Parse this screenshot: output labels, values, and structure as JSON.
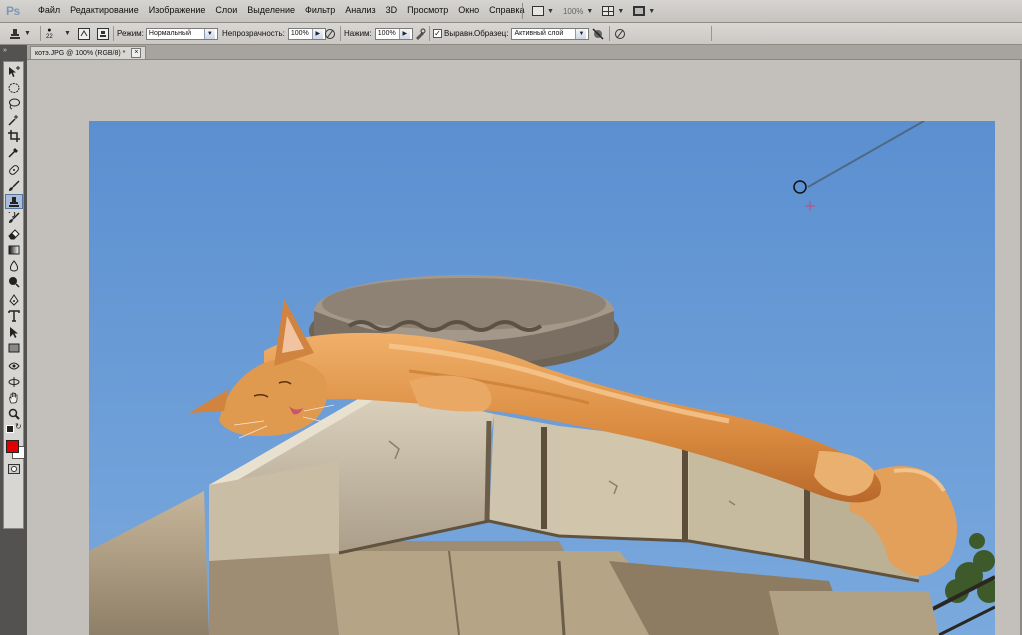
{
  "app": {
    "logo": "Ps"
  },
  "menu": [
    "Файл",
    "Редактирование",
    "Изображение",
    "Слои",
    "Выделение",
    "Фильтр",
    "Анализ",
    "3D",
    "Просмотр",
    "Окно",
    "Справка"
  ],
  "menu_right": {
    "zoom": "100%"
  },
  "options": {
    "brush_size": "22",
    "mode_label": "Режим:",
    "mode_value": "Нормальный",
    "opacity_label": "Непрозрачность:",
    "opacity_value": "100%",
    "pressure_label": "Нажим:",
    "pressure_value": "100%",
    "aligned_label": "Выравн.",
    "sample_label": "Образец:",
    "sample_value": "Активный слой"
  },
  "document": {
    "tab_title": "котэ.JPG @ 100% (RGB/8) *"
  },
  "colors": {
    "foreground": "#e00000",
    "background": "#ffffff",
    "accent": "#a9bcd8"
  },
  "tools": [
    "move-icon",
    "lasso-ellipse-icon",
    "lasso-icon",
    "magic-wand-icon",
    "crop-icon",
    "eyedropper-icon",
    "healing-icon",
    "brush-icon",
    "clone-stamp-icon",
    "history-brush-icon",
    "eraser-icon",
    "gradient-icon",
    "blur-icon",
    "dodge-icon",
    "pen-icon",
    "type-icon",
    "path-select-icon",
    "shape-icon",
    "3d-rotate-icon",
    "3d-orbit-icon",
    "hand-icon",
    "zoom-icon"
  ]
}
